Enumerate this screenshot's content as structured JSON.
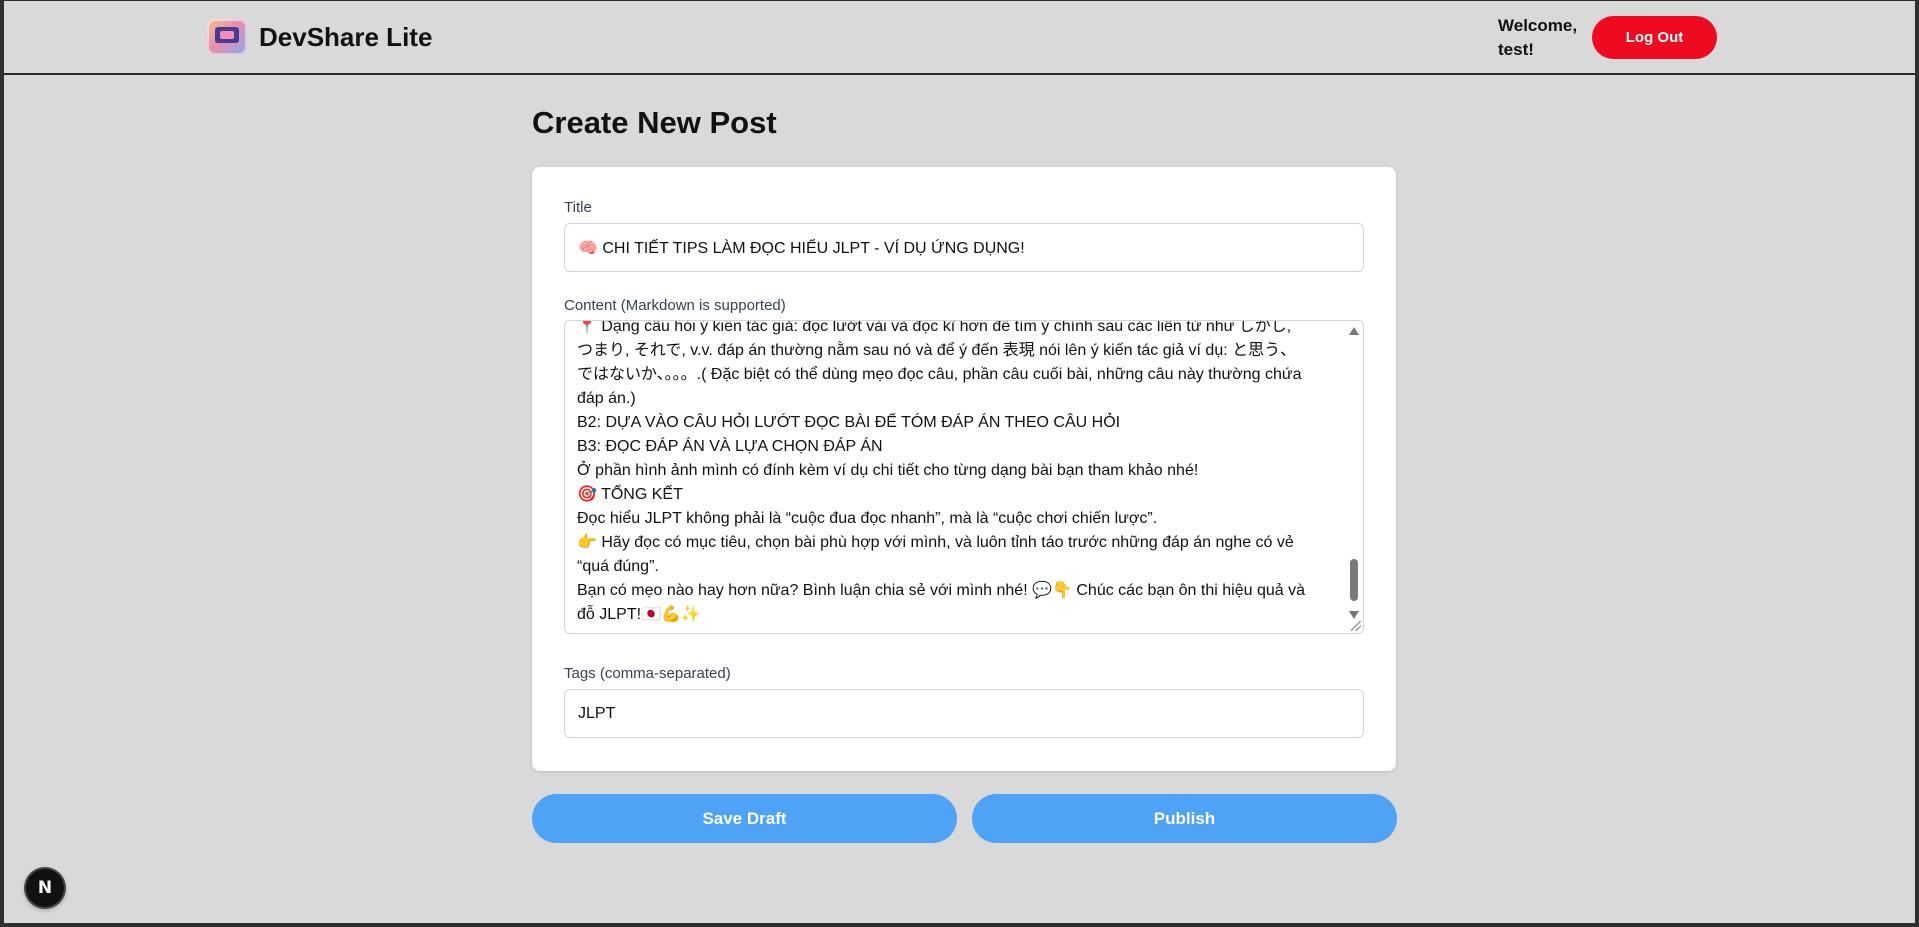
{
  "header": {
    "brand_name": "DevShare Lite",
    "welcome_text": "Welcome, test!",
    "logout_label": "Log Out"
  },
  "page": {
    "title": "Create New Post"
  },
  "form": {
    "title_label": "Title",
    "title_value": "🧠 CHI TIẾT TIPS LÀM ĐỌC HIỂU JLPT - VÍ DỤ ỨNG DỤNG!",
    "content_label": "Content (Markdown is supported)",
    "content_lines": [
      "📍 Dạng câu hỏi ý kiến tác giả: đọc lướt vài và đọc kĩ hơn để tìm ý chính sau các liên từ như しかし,",
      "つまり, それで, v.v. đáp án thường nằm sau nó  và để ý đến 表現 nói lên ý kiến tác giả ví dụ: と思う、",
      "ではないか、。。。.( Đặc biệt có thể dùng mẹo đọc câu, phần câu cuối bài, những câu này thường chứa",
      "đáp án.)",
      "B2: DỰA VÀO CÂU HỎI LƯỚT ĐỌC BÀI ĐỂ TÓM ĐÁP ÁN THEO CÂU HỎI",
      "B3: ĐỌC ĐÁP ÁN VÀ LỰA CHỌN ĐÁP ÁN",
      " Ở phần hình ảnh mình có đính kèm ví dụ chi tiết cho từng dạng bài bạn tham khảo nhé!",
      "🎯 TỔNG KẾT",
      "Đọc hiểu JLPT không phải là “cuộc đua đọc nhanh”, mà là “cuộc chơi chiến lược”.",
      "👉 Hãy đọc có mục tiêu, chọn bài phù hợp với mình, và luôn tỉnh táo trước những đáp án nghe có vẻ",
      "“quá đúng”.",
      "Bạn có mẹo nào hay hơn nữa? Bình luận chia sẻ với mình nhé! 💬👇 Chúc các bạn ôn thi hiệu quả và",
      "đỗ JLPT!🇯🇵💪✨"
    ],
    "tags_label": "Tags (comma-separated)",
    "tags_value": "JLPT"
  },
  "actions": {
    "save_draft_label": "Save Draft",
    "publish_label": "Publish"
  },
  "dev_badge": {
    "letter": "N"
  },
  "colors": {
    "background": "#d9d9d9",
    "logout": "#ee0a1f",
    "primary_button": "#4ea3f7",
    "card": "#ffffff"
  }
}
